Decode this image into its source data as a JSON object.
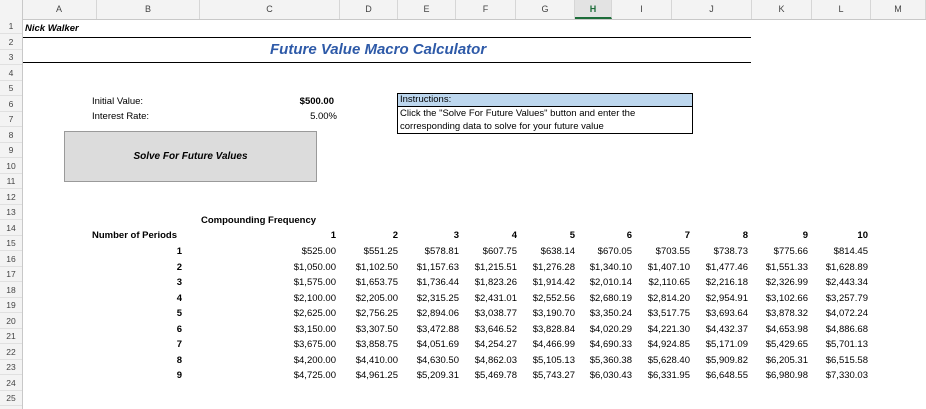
{
  "columns": [
    "A",
    "B",
    "C",
    "D",
    "E",
    "F",
    "G",
    "H",
    "I",
    "J",
    "K",
    "L",
    "M"
  ],
  "selected_column": "H",
  "rows": [
    "1",
    "2",
    "3",
    "4",
    "5",
    "6",
    "7",
    "8",
    "9",
    "10",
    "11",
    "12",
    "13",
    "14",
    "15",
    "16",
    "17",
    "18",
    "19",
    "20",
    "21",
    "22",
    "23",
    "24",
    "25"
  ],
  "author": "Nick Walker",
  "title": "Future Value Macro Calculator",
  "inputs": {
    "initial_value_label": "Initial Value:",
    "initial_value": "$500.00",
    "interest_rate_label": "Interest Rate:",
    "interest_rate": "5.00%"
  },
  "instructions": {
    "header": "Instructions:",
    "line1": "Click the \"Solve For Future Values\" button and enter the",
    "line2": "corresponding data to solve for your future value"
  },
  "button_label": "Solve For Future Values",
  "table": {
    "freq_label": "Compounding Frequency",
    "periods_label": "Number of Periods",
    "freq_headers": [
      "1",
      "2",
      "3",
      "4",
      "5",
      "6",
      "7",
      "8",
      "9",
      "10"
    ],
    "period_labels": [
      "1",
      "2",
      "3",
      "4",
      "5",
      "6",
      "7",
      "8",
      "9"
    ],
    "values": [
      [
        "$525.00",
        "$551.25",
        "$578.81",
        "$607.75",
        "$638.14",
        "$670.05",
        "$703.55",
        "$738.73",
        "$775.66",
        "$814.45"
      ],
      [
        "$1,050.00",
        "$1,102.50",
        "$1,157.63",
        "$1,215.51",
        "$1,276.28",
        "$1,340.10",
        "$1,407.10",
        "$1,477.46",
        "$1,551.33",
        "$1,628.89"
      ],
      [
        "$1,575.00",
        "$1,653.75",
        "$1,736.44",
        "$1,823.26",
        "$1,914.42",
        "$2,010.14",
        "$2,110.65",
        "$2,216.18",
        "$2,326.99",
        "$2,443.34"
      ],
      [
        "$2,100.00",
        "$2,205.00",
        "$2,315.25",
        "$2,431.01",
        "$2,552.56",
        "$2,680.19",
        "$2,814.20",
        "$2,954.91",
        "$3,102.66",
        "$3,257.79"
      ],
      [
        "$2,625.00",
        "$2,756.25",
        "$2,894.06",
        "$3,038.77",
        "$3,190.70",
        "$3,350.24",
        "$3,517.75",
        "$3,693.64",
        "$3,878.32",
        "$4,072.24"
      ],
      [
        "$3,150.00",
        "$3,307.50",
        "$3,472.88",
        "$3,646.52",
        "$3,828.84",
        "$4,020.29",
        "$4,221.30",
        "$4,432.37",
        "$4,653.98",
        "$4,886.68"
      ],
      [
        "$3,675.00",
        "$3,858.75",
        "$4,051.69",
        "$4,254.27",
        "$4,466.99",
        "$4,690.33",
        "$4,924.85",
        "$5,171.09",
        "$5,429.65",
        "$5,701.13"
      ],
      [
        "$4,200.00",
        "$4,410.00",
        "$4,630.50",
        "$4,862.03",
        "$5,105.13",
        "$5,360.38",
        "$5,628.40",
        "$5,909.82",
        "$6,205.31",
        "$6,515.58"
      ],
      [
        "$4,725.00",
        "$4,961.25",
        "$5,209.31",
        "$5,469.78",
        "$5,743.27",
        "$6,030.43",
        "$6,331.95",
        "$6,648.55",
        "$6,980.98",
        "$7,330.03"
      ]
    ]
  }
}
